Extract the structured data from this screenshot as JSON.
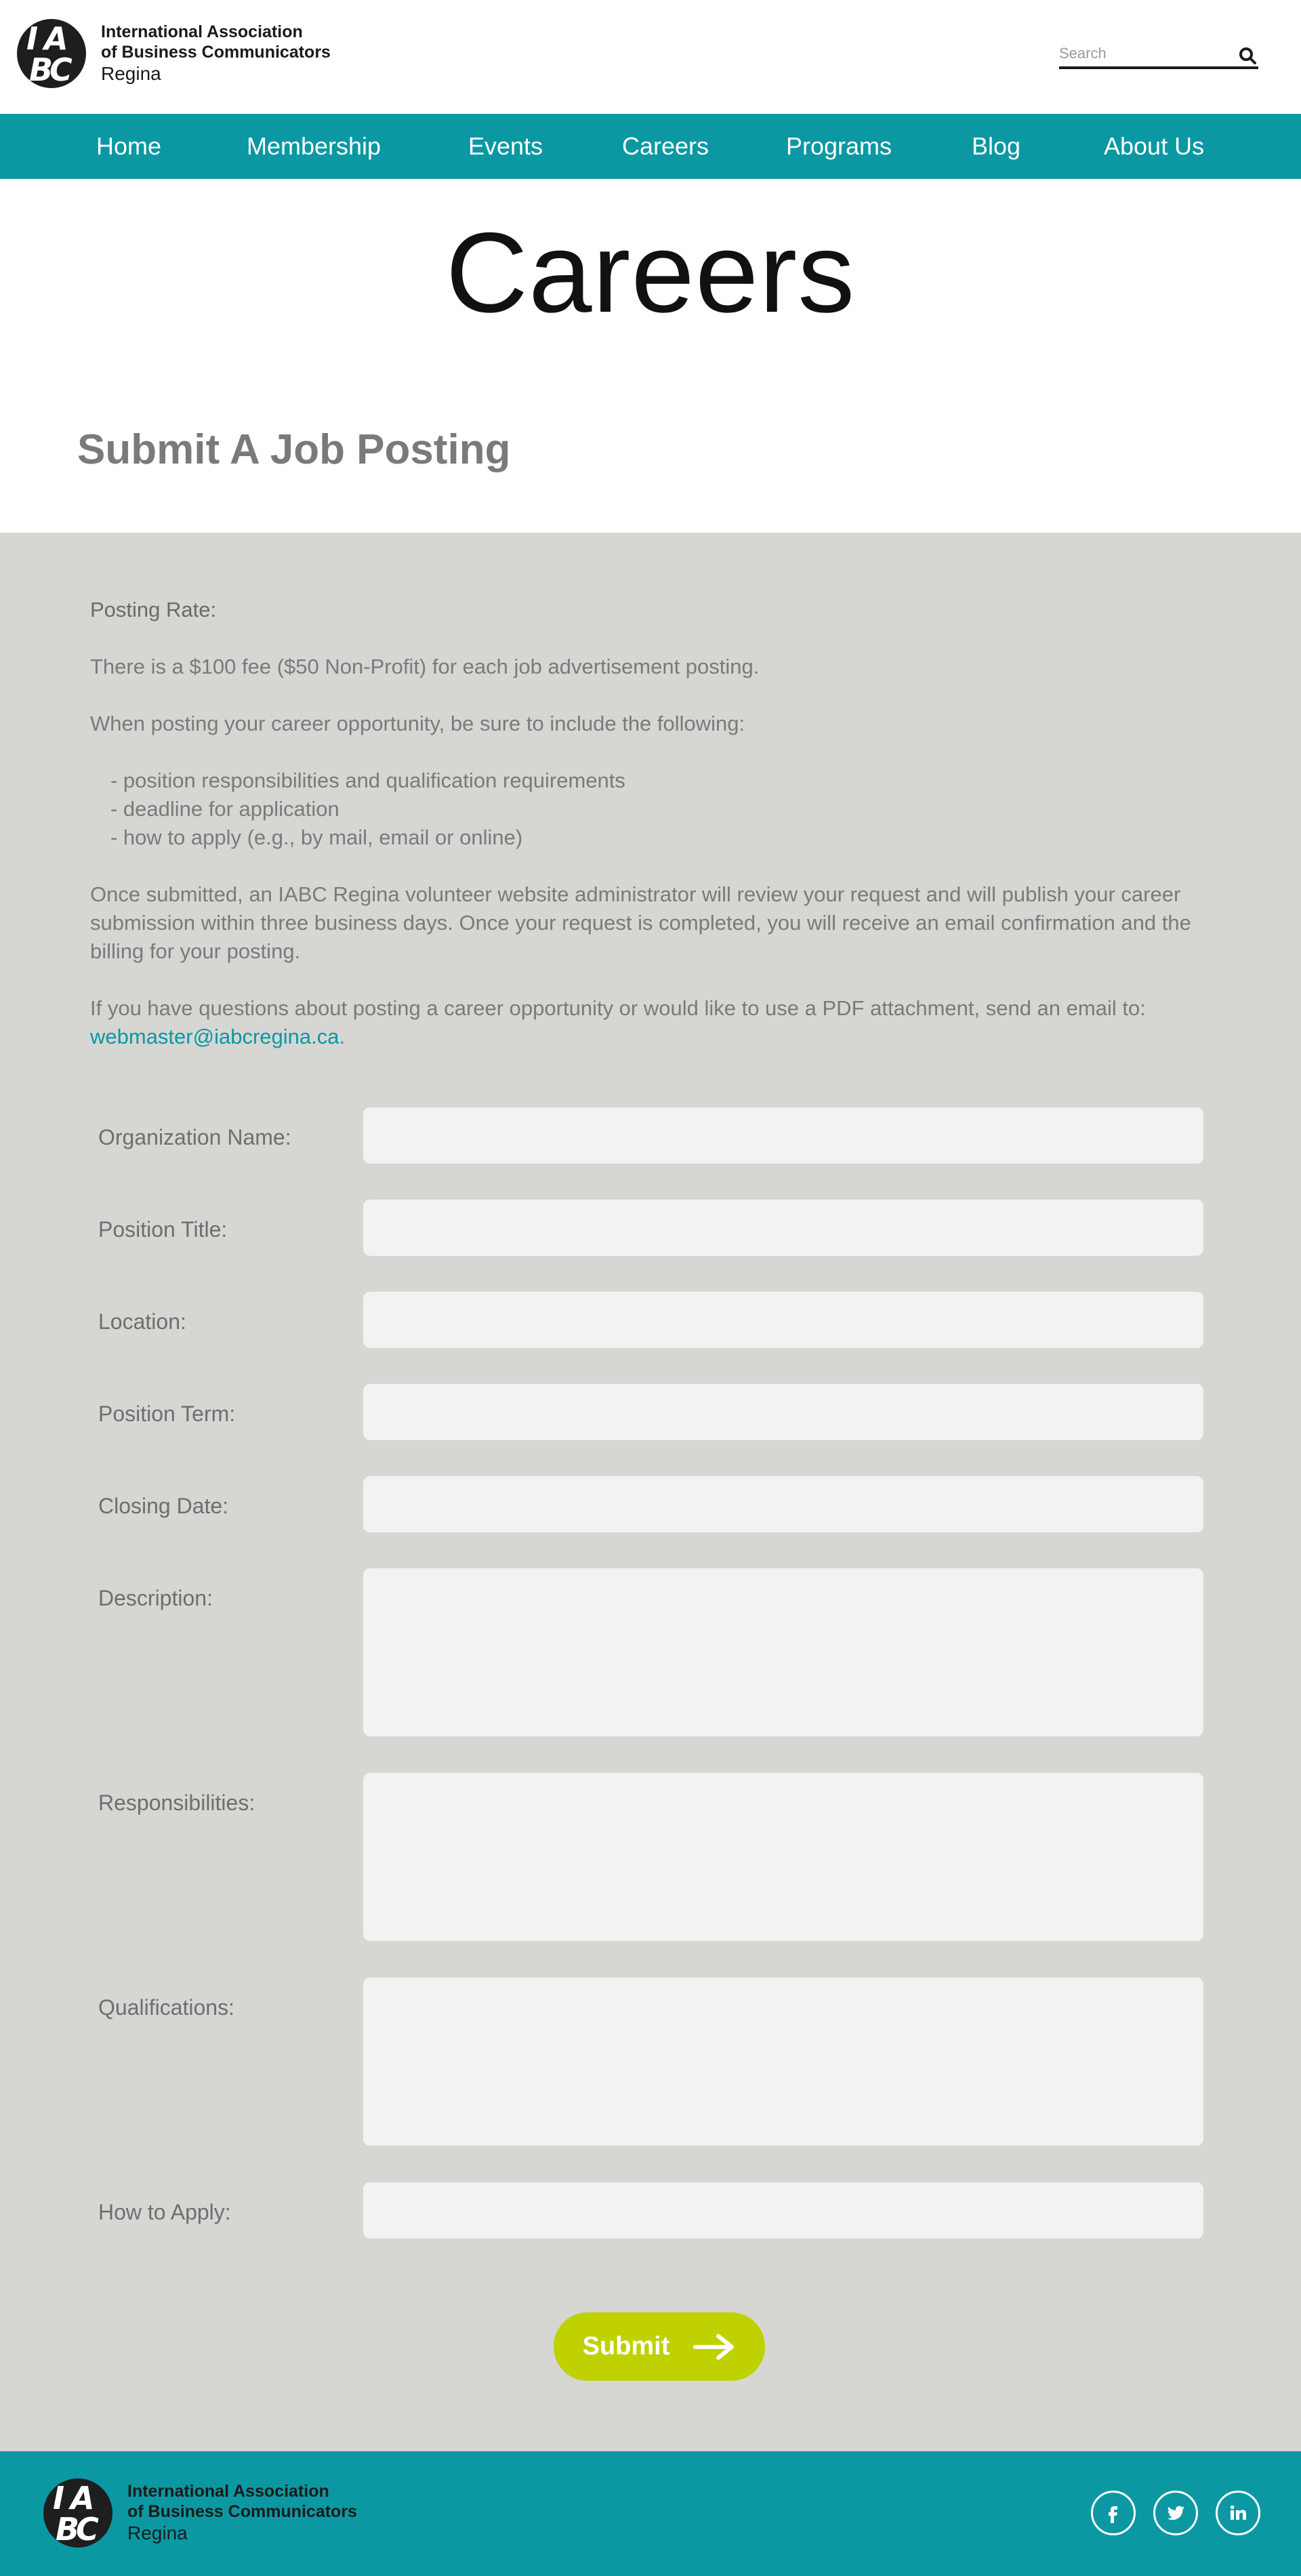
{
  "header": {
    "logo": {
      "line1": "International Association",
      "line2": "of Business Communicators",
      "line3": "Regina",
      "mark": [
        "I",
        "A",
        "B",
        "C"
      ]
    },
    "search": {
      "placeholder": "Search",
      "icon": "search-icon"
    }
  },
  "nav": {
    "items": [
      {
        "label": "Home"
      },
      {
        "label": "Membership"
      },
      {
        "label": "Events"
      },
      {
        "label": "Careers"
      },
      {
        "label": "Programs"
      },
      {
        "label": "Blog"
      },
      {
        "label": "About Us"
      }
    ]
  },
  "page": {
    "title": "Careers",
    "section_title": "Submit A Job Posting"
  },
  "intro": {
    "rate_label": "Posting Rate:",
    "fee": "There is a $100 fee ($50 Non-Profit) for each job advertisement posting.",
    "include": "When posting your career opportunity, be sure to include the following:",
    "bullets": [
      "- position responsibilities and qualification requirements",
      "- deadline for application",
      "- how to apply (e.g., by mail, email or online)"
    ],
    "review": "Once submitted, an IABC Regina volunteer website administrator will review your request and will publish your career submission within three business days. Once your request is completed, you will receive an email confirmation and the billing for your posting.",
    "questions": "If you have questions about posting a career opportunity or would like to use a PDF attachment, send an email to:",
    "email": "webmaster@iabcregina.ca",
    "period": "."
  },
  "form": {
    "fields": [
      {
        "label": "Organization Name:",
        "value": ""
      },
      {
        "label": "Position Title:",
        "value": ""
      },
      {
        "label": "Location:",
        "value": ""
      },
      {
        "label": "Position Term:",
        "value": ""
      },
      {
        "label": "Closing Date:",
        "value": ""
      },
      {
        "label": "Description:",
        "value": ""
      },
      {
        "label": "Responsibilities:",
        "value": ""
      },
      {
        "label": "Qualifications:",
        "value": ""
      },
      {
        "label": "How to Apply:",
        "value": ""
      }
    ],
    "submit_label": "Submit"
  },
  "footer": {
    "logo": {
      "line1": "International Association",
      "line2": "of Business Communicators",
      "line3": "Regina",
      "mark": [
        "I",
        "A",
        "B",
        "C"
      ]
    },
    "social": [
      {
        "icon": "facebook-icon",
        "glyph": "f"
      },
      {
        "icon": "twitter-icon",
        "glyph": "t"
      },
      {
        "icon": "linkedin-icon",
        "glyph": "in"
      }
    ]
  },
  "colors": {
    "brand_teal": "#0b98a3",
    "content_grey": "#d6d6d2",
    "submit_green": "#bfd200",
    "field_bg": "#f2f2f2"
  }
}
